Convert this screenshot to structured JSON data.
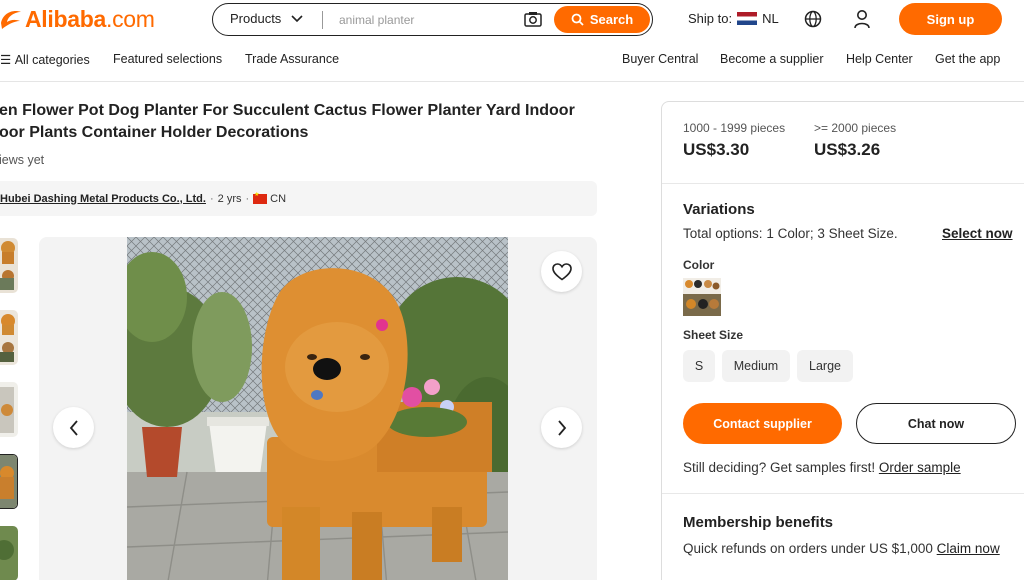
{
  "header": {
    "logo_text": "Alibaba",
    "logo_suffix": ".com",
    "search_category": "Products",
    "search_placeholder": "animal planter",
    "search_button": "Search",
    "ship_to_label": "Ship to:",
    "ship_to_country": "NL",
    "signup_label": "Sign up",
    "brand_color": "#ff6a00"
  },
  "nav": {
    "all_categories": "All categories",
    "featured": "Featured selections",
    "trade_assurance": "Trade Assurance",
    "buyer_central": "Buyer Central",
    "become_supplier": "Become a supplier",
    "help_center": "Help Center",
    "get_app": "Get the app"
  },
  "product": {
    "title_line1": "en Flower Pot Dog Planter For Succulent Cactus Flower Planter Yard Indoor",
    "title_line2": "oor Plants Container Holder Decorations",
    "reviews": "iews yet",
    "supplier_name": "Hubei Dashing Metal Products Co., Ltd.",
    "supplier_years": "2 yrs",
    "supplier_country": "CN"
  },
  "pricing": {
    "tiers": [
      {
        "range": "1000 - 1999 pieces",
        "price": "US$3.30"
      },
      {
        "range": ">= 2000 pieces",
        "price": "US$3.26"
      }
    ]
  },
  "variations": {
    "title": "Variations",
    "total_label": "Total options:",
    "total_value": "1 Color; 3 Sheet Size.",
    "select_now": "Select now",
    "color_label": "Color",
    "size_label": "Sheet Size",
    "sizes": [
      "S",
      "Medium",
      "Large"
    ]
  },
  "actions": {
    "contact": "Contact supplier",
    "chat": "Chat now",
    "deciding_text": "Still deciding? Get samples first!",
    "order_sample": "Order sample"
  },
  "membership": {
    "title": "Membership benefits",
    "text": "Quick refunds on orders under US $1,000",
    "claim": "Claim now"
  }
}
